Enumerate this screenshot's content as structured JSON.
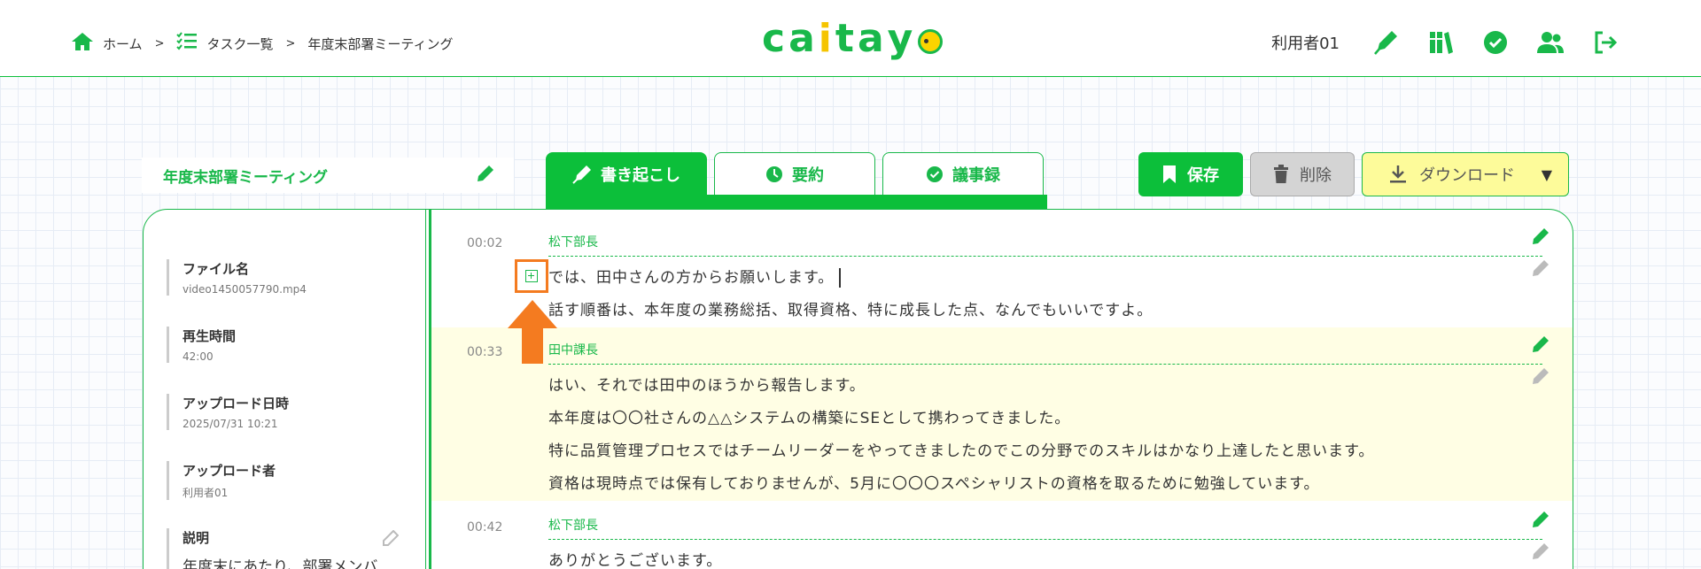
{
  "breadcrumb": {
    "home": "ホーム",
    "tasks": "タスク一覧",
    "current": "年度末部署ミーティング",
    "separator": ">"
  },
  "logo": {
    "c": "c",
    "a": "a",
    "i": "i",
    "t": "t",
    "a2": "a",
    "y": "y"
  },
  "header": {
    "user": "利用者01"
  },
  "title": "年度末部署ミーティング",
  "tabs": [
    {
      "label": "書き起こし",
      "icon": "pen-nib-icon",
      "active": true
    },
    {
      "label": "要約",
      "icon": "clock-icon",
      "active": false
    },
    {
      "label": "議事録",
      "icon": "check-circle-icon",
      "active": false
    }
  ],
  "actions": {
    "save": "保存",
    "delete": "削除",
    "download": "ダウンロード",
    "download_caret": "▼"
  },
  "sidebar": {
    "file_label": "ファイル名",
    "file_value": "video1450057790.mp4",
    "duration_label": "再生時間",
    "duration_value": "42:00",
    "upload_date_label": "アップロード日時",
    "upload_date_value": "2025/07/31 10:21",
    "uploader_label": "アップロード者",
    "uploader_value": "利用者01",
    "description_label": "説明",
    "description_value": "年度末にあたり、部署メンバ"
  },
  "segments": [
    {
      "time": "00:02",
      "speaker": "松下部長",
      "lines": [
        "では、田中さんの方からお願いします。",
        "話す順番は、本年度の業務総括、取得資格、特に成長した点、なんでもいいですよ。"
      ]
    },
    {
      "time": "00:33",
      "speaker": "田中課長",
      "lines": [
        "はい、それでは田中のほうから報告します。",
        "本年度は〇〇社さんの△△システムの構築にSEとして携わってきました。",
        "特に品質管理プロセスではチームリーダーをやってきましたのでこの分野でのスキルはかなり上達したと思います。",
        "資格は現時点では保有しておりませんが、5月に〇〇〇スペシャリストの資格を取るために勉強しています。"
      ]
    },
    {
      "time": "00:42",
      "speaker": "松下部長",
      "lines": [
        "ありがとうございます。"
      ]
    }
  ],
  "colors": {
    "brand_green": "#0cbf3a",
    "highlight": "#fffee4",
    "annotation_orange": "#f47b20",
    "download_yellow": "#fdfb9a"
  }
}
